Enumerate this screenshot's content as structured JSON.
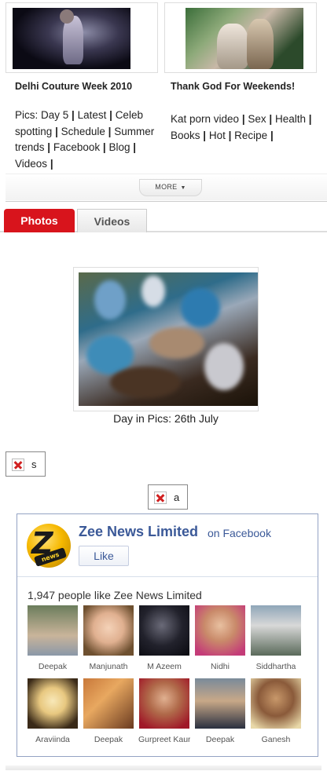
{
  "features": [
    {
      "title": "Delhi Couture Week 2010",
      "links": [
        "Pics: Day 5",
        "Latest",
        "Celeb spotting",
        "Schedule",
        "Summer trends",
        "Facebook",
        "Blog",
        "Videos"
      ]
    },
    {
      "title": "Thank God For Weekends!",
      "links": [
        "Kat porn video",
        "Sex",
        "Health",
        "Books",
        "Hot",
        "Recipe"
      ]
    }
  ],
  "separator": "|",
  "more_label": "MORE",
  "tabs": [
    {
      "label": "Photos",
      "active": true
    },
    {
      "label": "Videos",
      "active": false
    }
  ],
  "photo": {
    "caption": "Day in Pics: 26th July"
  },
  "broken_images": [
    {
      "alt": "s"
    },
    {
      "alt": "a"
    }
  ],
  "facebook": {
    "page_name": "Zee News Limited",
    "on_text": "on Facebook",
    "like_label": "Like",
    "logo_text": "news",
    "count_text": "1,947 people like Zee News Limited",
    "fans": [
      {
        "name": "Deepak"
      },
      {
        "name": "Manjunath"
      },
      {
        "name": "M Azeem"
      },
      {
        "name": "Nidhi"
      },
      {
        "name": "Siddhartha"
      },
      {
        "name": "Araviinda"
      },
      {
        "name": "Deepak"
      },
      {
        "name": "Gurpreet Kaur"
      },
      {
        "name": "Deepak"
      },
      {
        "name": "Ganesh"
      }
    ]
  },
  "colors": {
    "tab_active": "#d8141c",
    "facebook_blue": "#3b5998",
    "broken_x": "#d12020"
  }
}
